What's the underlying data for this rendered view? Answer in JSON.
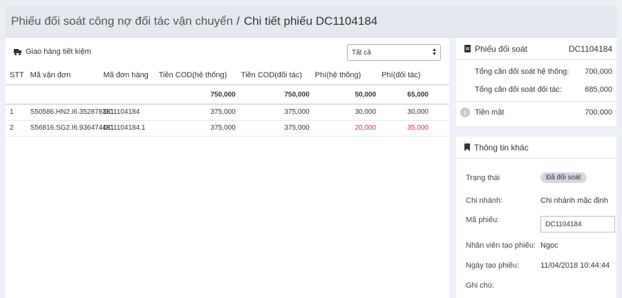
{
  "breadcrumb": {
    "parent": "Phiếu đối soát công nợ đối tác vận chuyển",
    "separator": "/",
    "current": "Chi tiết phiếu DC1104184"
  },
  "carrier": {
    "name": "Giao hàng tiết kiệm",
    "icon": "truck-icon"
  },
  "filter": {
    "selected": "Tất cả"
  },
  "table": {
    "headers": [
      "STT",
      "Mã vận đơn",
      "Mã đơn hàng",
      "Tiền COD(hệ thống)",
      "Tiền COD(đối tác)",
      "Phí(hệ thống)",
      "Phí(đối tác)"
    ],
    "totals": {
      "cod_system": "750,000",
      "cod_partner": "750,000",
      "fee_system": "50,000",
      "fee_partner": "65,000"
    },
    "rows": [
      {
        "stt": "1",
        "tracking": "S50586.HN2.I6.352878361",
        "order": "DC1104184",
        "cod_system": "375,000",
        "cod_partner": "375,000",
        "fee_system": "30,000",
        "fee_partner": "30,000"
      },
      {
        "stt": "2",
        "tracking": "S56816.SG2.I6.936474461",
        "order": "DC1104184.1",
        "cod_system": "375,000",
        "cod_partner": "375,000",
        "fee_system": "20,000",
        "fee_partner": "35,000"
      }
    ]
  },
  "summary": {
    "title": "Phiếu đối soát",
    "code": "DC1104184",
    "system_label": "Tổng cần đối soát hệ thống:",
    "system_value": "700,000",
    "partner_label": "Tổng cần đối soát đối tác:",
    "partner_value": "685,000",
    "cash_index": "1",
    "cash_label": "Tiền mặt",
    "cash_value": "700,000"
  },
  "info": {
    "title": "Thông tin khác",
    "status_label": "Trạng thái",
    "status_value": "Đã đối soát",
    "branch_label": "Chi nhánh:",
    "branch_value": "Chi nhánh mặc định",
    "code_label": "Mã phiếu:",
    "code_value": "DC1104184",
    "creator_label": "Nhân viên tạo phiếu:",
    "creator_value": "Ngọc",
    "date_label": "Ngày tạo phiếu:",
    "date_value": "11/04/2018 10:44:44",
    "note_label": "Ghi chú:"
  },
  "colors": {
    "fee_mismatch": "#e0301e",
    "background": "#ecf0f5"
  }
}
